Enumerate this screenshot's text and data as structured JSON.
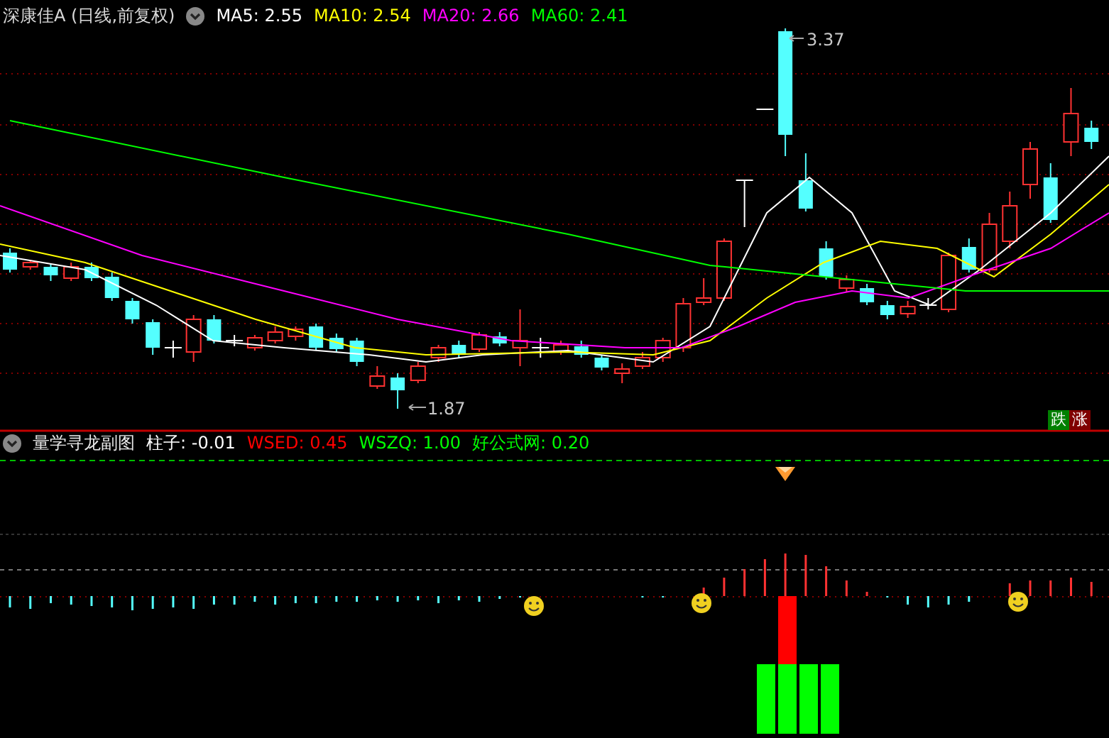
{
  "main_panel": {
    "title": "深康佳A (日线,前复权)",
    "indicators": [
      {
        "label": "MA5: 2.55",
        "color": "#ffffff"
      },
      {
        "label": "MA10: 2.54",
        "color": "#ffff00"
      },
      {
        "label": "MA20: 2.66",
        "color": "#ff00ff"
      },
      {
        "label": "MA60: 2.41",
        "color": "#00ff00"
      }
    ],
    "high_label": "3.37",
    "low_label": "1.87",
    "badges": [
      {
        "label": "跌",
        "color": "#008000"
      },
      {
        "label": "涨",
        "color": "#800000"
      }
    ]
  },
  "sub_panel": {
    "title": "量学寻龙副图",
    "indicators": [
      {
        "label": "柱子: -0.01",
        "color": "#ffffff"
      },
      {
        "label": "WSED: 0.45",
        "color": "#ff0000"
      },
      {
        "label": "WSZQ: 1.00",
        "color": "#00ff00"
      },
      {
        "label": "好公式网: 0.20",
        "color": "#00ff00"
      }
    ]
  }
}
